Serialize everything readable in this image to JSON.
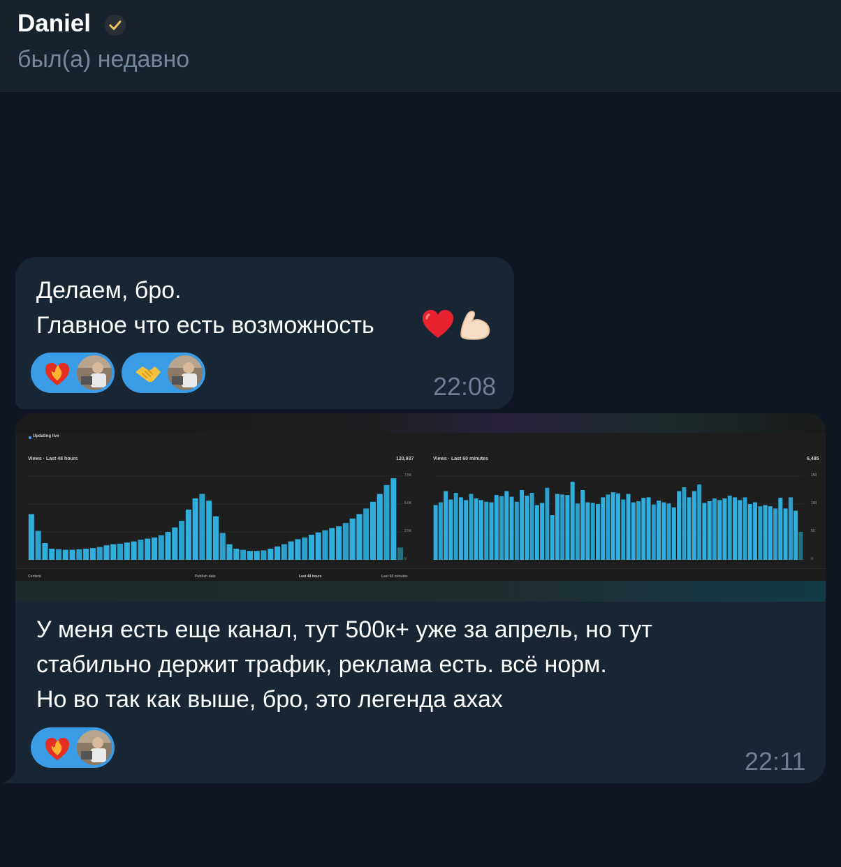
{
  "header": {
    "contact_name": "Daniel",
    "status": "был(а) недавно"
  },
  "messages": [
    {
      "lines": [
        "Делаем, бро.",
        "Главное что есть возможность"
      ],
      "emoji_end": [
        "red-heart",
        "flexed-biceps"
      ],
      "reactions": [
        {
          "emoji": "heart-on-fire",
          "user": "avatar"
        },
        {
          "emoji": "handshake",
          "user": "avatar"
        }
      ],
      "time": "22:08"
    },
    {
      "screenshot": {
        "live_label": "Updating live",
        "left_panel": {
          "title": "Views · Last 48 hours",
          "total": "120,937",
          "ticks": [
            "7.5K",
            "5.0K",
            "2.5K",
            "0"
          ]
        },
        "right_panel": {
          "title": "Views · Last 60 minutes",
          "total": "6,485",
          "ticks": [
            "150",
            "100",
            "50",
            "0"
          ]
        },
        "table_headers": [
          "Content",
          "Publish date",
          "Last 48 hours",
          "Last 60 minutes"
        ]
      },
      "lines": [
        "У меня есть еще канал, тут 500к+ уже за апрель, но тут",
        "стабильно держит трафик, реклама есть. всё норм.",
        "Но во так как выше, бро, это легенда ахах"
      ],
      "reactions": [
        {
          "emoji": "heart-on-fire",
          "user": "avatar"
        }
      ],
      "time": "22:11"
    }
  ],
  "chart_data": [
    {
      "type": "bar",
      "title": "Views · Last 48 hours",
      "ylim": [
        0,
        7500
      ],
      "y_ticks": [
        "7.5K",
        "5.0K",
        "2.5K",
        "0"
      ],
      "values": [
        4100,
        2600,
        1500,
        1000,
        950,
        900,
        900,
        950,
        1000,
        1050,
        1150,
        1300,
        1400,
        1450,
        1550,
        1650,
        1800,
        1900,
        2000,
        2200,
        2500,
        2900,
        3500,
        4500,
        5500,
        5900,
        5300,
        3900,
        2400,
        1400,
        1000,
        900,
        800,
        800,
        850,
        1000,
        1200,
        1400,
        1650,
        1850,
        2000,
        2250,
        2450,
        2650,
        2850,
        3000,
        3300,
        3700,
        4100,
        4600,
        5200,
        5900,
        6700,
        7300,
        1100
      ]
    },
    {
      "type": "bar",
      "title": "Views · Last 60 minutes",
      "ylim": [
        0,
        150
      ],
      "y_ticks": [
        "150",
        "100",
        "50",
        "0"
      ],
      "values": [
        98,
        103,
        123,
        108,
        120,
        112,
        107,
        118,
        110,
        107,
        104,
        103,
        116,
        114,
        123,
        113,
        104,
        125,
        115,
        120,
        98,
        102,
        129,
        80,
        118,
        117,
        116,
        140,
        101,
        125,
        103,
        102,
        100,
        112,
        117,
        121,
        119,
        108,
        118,
        103,
        105,
        111,
        112,
        99,
        106,
        103,
        101,
        94,
        123,
        130,
        112,
        123,
        135,
        102,
        105,
        110,
        107,
        110,
        115,
        112,
        107,
        112,
        100,
        103,
        96,
        98,
        96,
        92,
        111,
        92,
        112,
        88,
        50
      ]
    }
  ]
}
